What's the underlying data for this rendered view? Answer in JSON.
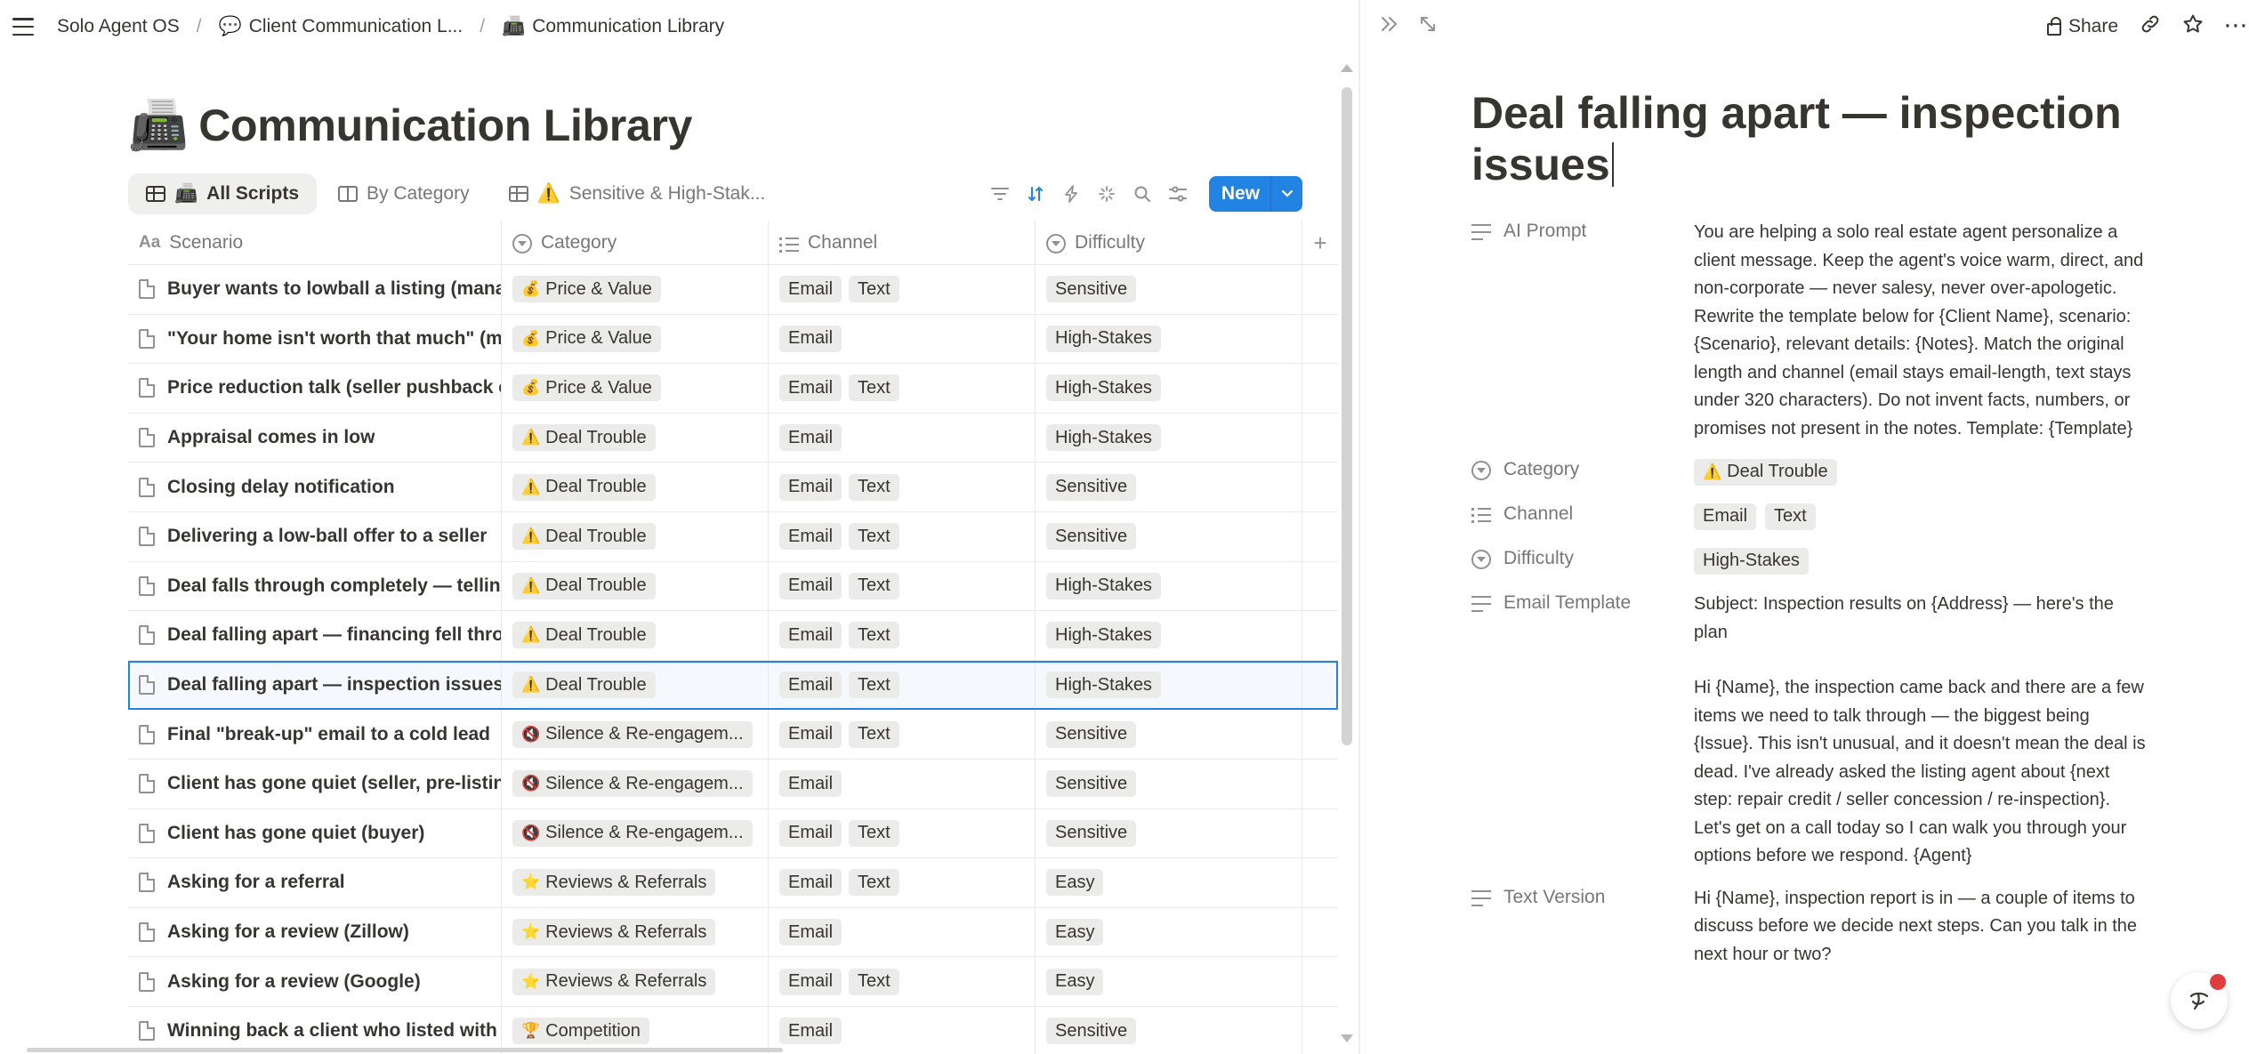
{
  "breadcrumb": {
    "workspace": "Solo Agent OS",
    "parent": "Client Communication L...",
    "current": "Communication Library",
    "parent_icon": "💬",
    "current_icon": "📠"
  },
  "page": {
    "title": "Communication Library",
    "icon": "📠"
  },
  "views": [
    {
      "label": "All Scripts",
      "emoji": "📠",
      "icon": "table-icon",
      "active": true
    },
    {
      "label": "By Category",
      "emoji": "",
      "icon": "board-icon",
      "active": false
    },
    {
      "label": "Sensitive & High-Stak...",
      "emoji": "⚠️",
      "icon": "table-icon",
      "active": false
    }
  ],
  "toolbar": {
    "new_label": "New"
  },
  "columns": {
    "scenario": "Scenario",
    "category": "Category",
    "channel": "Channel",
    "difficulty": "Difficulty"
  },
  "rows": [
    {
      "scenario": "Buyer wants to lowball a listing (managi",
      "category": "Price & Value",
      "cat_emoji": "💰",
      "channels": [
        "Email",
        "Text"
      ],
      "difficulty": "Sensitive"
    },
    {
      "scenario": "\"Your home isn't worth that much\" (ma",
      "category": "Price & Value",
      "cat_emoji": "💰",
      "channels": [
        "Email"
      ],
      "difficulty": "High-Stakes"
    },
    {
      "scenario": "Price reduction talk (seller pushback ex",
      "category": "Price & Value",
      "cat_emoji": "💰",
      "channels": [
        "Email",
        "Text"
      ],
      "difficulty": "High-Stakes"
    },
    {
      "scenario": "Appraisal comes in low",
      "category": "Deal Trouble",
      "cat_emoji": "⚠️",
      "channels": [
        "Email"
      ],
      "difficulty": "High-Stakes"
    },
    {
      "scenario": "Closing delay notification",
      "category": "Deal Trouble",
      "cat_emoji": "⚠️",
      "channels": [
        "Email",
        "Text"
      ],
      "difficulty": "Sensitive"
    },
    {
      "scenario": "Delivering a low-ball offer to a seller",
      "category": "Deal Trouble",
      "cat_emoji": "⚠️",
      "channels": [
        "Email",
        "Text"
      ],
      "difficulty": "Sensitive"
    },
    {
      "scenario": "Deal falls through completely — telling",
      "category": "Deal Trouble",
      "cat_emoji": "⚠️",
      "channels": [
        "Email",
        "Text"
      ],
      "difficulty": "High-Stakes"
    },
    {
      "scenario": "Deal falling apart — financing fell throu",
      "category": "Deal Trouble",
      "cat_emoji": "⚠️",
      "channels": [
        "Email",
        "Text"
      ],
      "difficulty": "High-Stakes"
    },
    {
      "scenario": "Deal falling apart — inspection issues",
      "category": "Deal Trouble",
      "cat_emoji": "⚠️",
      "channels": [
        "Email",
        "Text"
      ],
      "difficulty": "High-Stakes",
      "selected": true
    },
    {
      "scenario": "Final \"break-up\" email to a cold lead",
      "category": "Silence & Re-engagem...",
      "cat_emoji": "🔇",
      "channels": [
        "Email",
        "Text"
      ],
      "difficulty": "Sensitive"
    },
    {
      "scenario": "Client has gone quiet (seller, pre-listing",
      "category": "Silence & Re-engagem...",
      "cat_emoji": "🔇",
      "channels": [
        "Email"
      ],
      "difficulty": "Sensitive"
    },
    {
      "scenario": "Client has gone quiet (buyer)",
      "category": "Silence & Re-engagem...",
      "cat_emoji": "🔇",
      "channels": [
        "Email",
        "Text"
      ],
      "difficulty": "Sensitive"
    },
    {
      "scenario": "Asking for a referral",
      "category": "Reviews & Referrals",
      "cat_emoji": "⭐",
      "channels": [
        "Email",
        "Text"
      ],
      "difficulty": "Easy"
    },
    {
      "scenario": "Asking for a review (Zillow)",
      "category": "Reviews & Referrals",
      "cat_emoji": "⭐",
      "channels": [
        "Email"
      ],
      "difficulty": "Easy"
    },
    {
      "scenario": "Asking for a review (Google)",
      "category": "Reviews & Referrals",
      "cat_emoji": "⭐",
      "channels": [
        "Email",
        "Text"
      ],
      "difficulty": "Easy"
    },
    {
      "scenario": "Winning back a client who listed with a",
      "category": "Competition",
      "cat_emoji": "🏆",
      "channels": [
        "Email"
      ],
      "difficulty": "Sensitive"
    }
  ],
  "detail": {
    "share_label": "Share",
    "title": "Deal falling apart — inspection issues",
    "props": {
      "ai_prompt_label": "AI Prompt",
      "ai_prompt": "You are helping a solo real estate agent personalize a client message. Keep the agent's voice warm, direct, and non-corporate — never salesy, never over-apologetic. Rewrite the template below for {Client Name}, scenario: {Scenario}, relevant details: {Notes}. Match the original length and channel (email stays email-length, text stays under 320 characters). Do not invent facts, numbers, or promises not present in the notes. Template: {Template}",
      "category_label": "Category",
      "category": "Deal Trouble",
      "category_emoji": "⚠️",
      "channel_label": "Channel",
      "channels": [
        "Email",
        "Text"
      ],
      "difficulty_label": "Difficulty",
      "difficulty": "High-Stakes",
      "email_template_label": "Email Template",
      "email_subject": "Subject: Inspection results on {Address} — here's the plan",
      "email_body": "Hi {Name}, the inspection came back and there are a few items we need to talk through — the biggest being {Issue}. This isn't unusual, and it doesn't mean the deal is dead. I've already asked the listing agent about {next step: repair credit / seller concession / re-inspection}. Let's get on a call today so I can walk you through your options before we respond. {Agent}",
      "text_version_label": "Text Version",
      "text_version": "Hi {Name}, inspection report is in — a couple of items to discuss before we decide next steps. Can you talk in the next hour or two?"
    }
  }
}
